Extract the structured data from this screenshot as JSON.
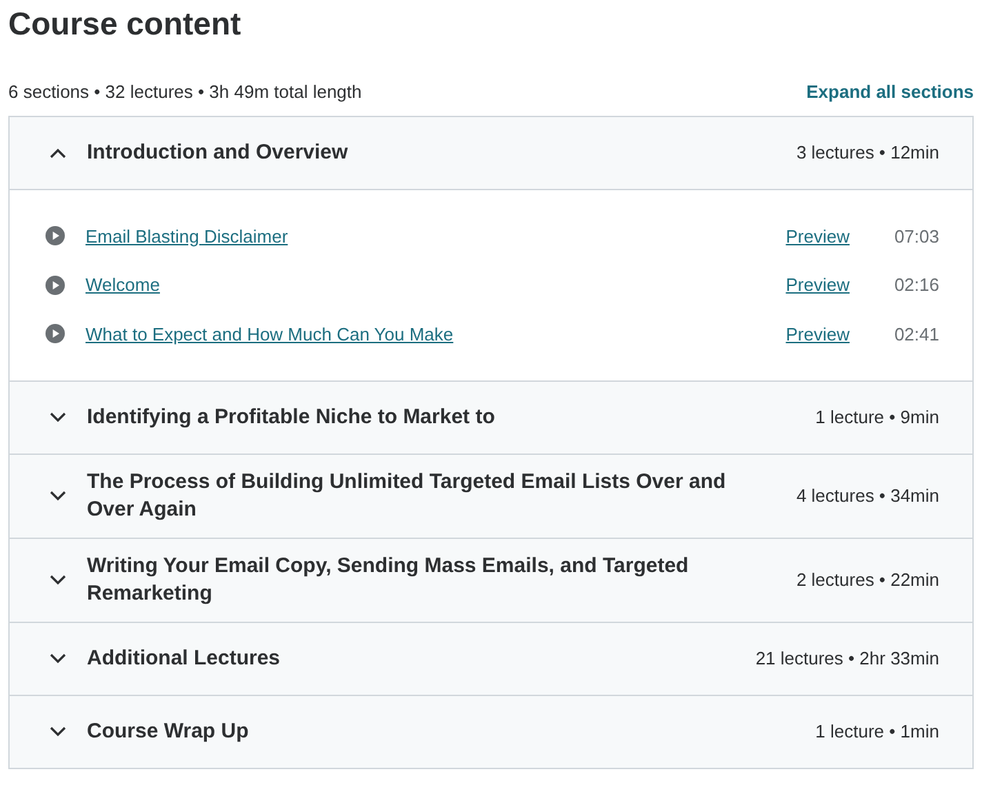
{
  "title": "Course content",
  "summary": "6 sections • 32 lectures • 3h 49m total length",
  "expand_all": "Expand all sections",
  "sections": [
    {
      "title": "Introduction and Overview",
      "meta": "3 lectures • 12min",
      "expanded": true,
      "lectures": [
        {
          "title": "Email Blasting Disclaimer",
          "preview": "Preview",
          "duration": "07:03"
        },
        {
          "title": "Welcome",
          "preview": "Preview",
          "duration": "02:16"
        },
        {
          "title": "What to Expect and How Much Can You Make",
          "preview": "Preview",
          "duration": "02:41"
        }
      ]
    },
    {
      "title": "Identifying a Profitable Niche to Market to",
      "meta": "1 lecture • 9min",
      "expanded": false
    },
    {
      "title": "The Process of Building Unlimited Targeted Email Lists Over and Over Again",
      "meta": "4 lectures • 34min",
      "expanded": false
    },
    {
      "title": "Writing Your Email Copy, Sending Mass Emails, and Targeted Remarketing",
      "meta": "2 lectures • 22min",
      "expanded": false
    },
    {
      "title": "Additional Lectures",
      "meta": "21 lectures • 2hr 33min",
      "expanded": false
    },
    {
      "title": "Course Wrap Up",
      "meta": "1 lecture • 1min",
      "expanded": false
    }
  ]
}
